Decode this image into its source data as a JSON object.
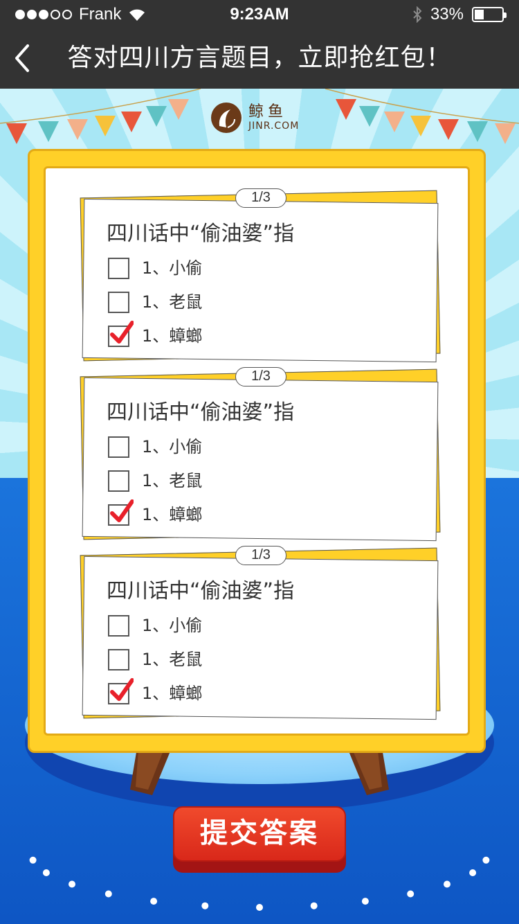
{
  "status_bar": {
    "carrier": "Frank",
    "time": "9:23AM",
    "battery": "33%",
    "signal_filled": 3,
    "signal_total": 5,
    "battery_fraction": 0.33
  },
  "nav": {
    "title": "答对四川方言题目，立即抢红包！",
    "back_icon": "chevron-left-icon"
  },
  "logo": {
    "name_cn": "鲸鱼",
    "name_en": "JINR.COM"
  },
  "colors": {
    "nav_bg": "#333333",
    "board_yellow": "#ffd028",
    "check_red": "#e8202a",
    "button_red": "#e23a22",
    "floor_blue": "#1b74dc"
  },
  "questions": [
    {
      "progress": "1/3",
      "text": "四川话中“偷油婆”指",
      "options": [
        {
          "label": "1、小偷",
          "checked": false
        },
        {
          "label": "1、老鼠",
          "checked": false
        },
        {
          "label": "1、蟑螂",
          "checked": true
        }
      ]
    },
    {
      "progress": "1/3",
      "text": "四川话中“偷油婆”指",
      "options": [
        {
          "label": "1、小偷",
          "checked": false
        },
        {
          "label": "1、老鼠",
          "checked": false
        },
        {
          "label": "1、蟑螂",
          "checked": true
        }
      ]
    },
    {
      "progress": "1/3",
      "text": "四川话中“偷油婆”指",
      "options": [
        {
          "label": "1、小偷",
          "checked": false
        },
        {
          "label": "1、老鼠",
          "checked": false
        },
        {
          "label": "1、蟑螂",
          "checked": true
        }
      ]
    }
  ],
  "submit": {
    "label": "提交答案"
  }
}
